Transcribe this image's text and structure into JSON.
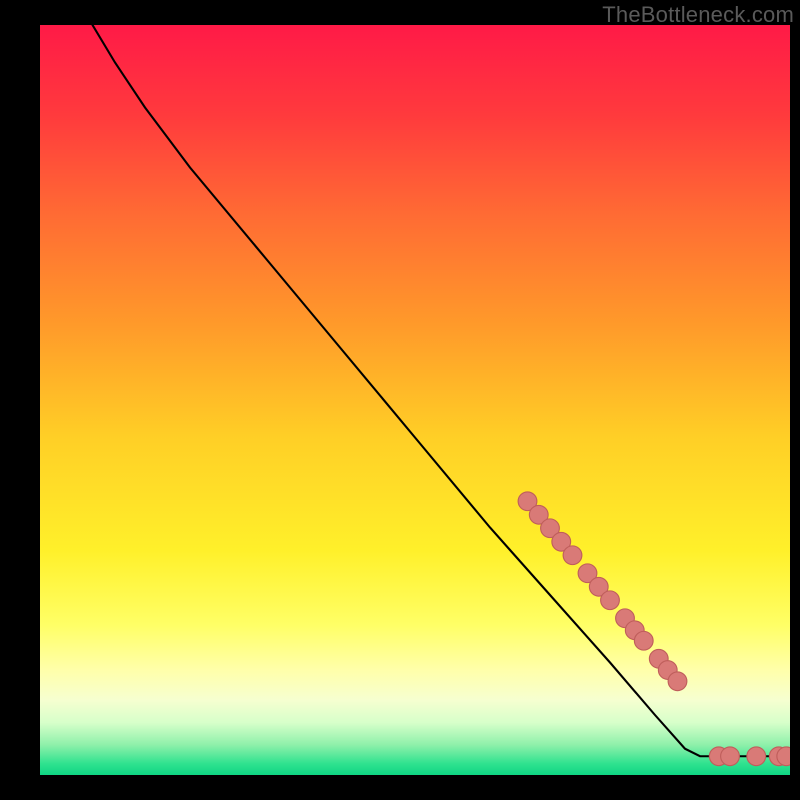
{
  "watermark": "TheBottleneck.com",
  "colors": {
    "bg": "#000000",
    "watermark_text": "#5a5a5a",
    "curve": "#000000",
    "marker_fill": "#d97a77",
    "marker_stroke": "#bf5e5b"
  },
  "chart_data": {
    "type": "line",
    "title": "",
    "xlabel": "",
    "ylabel": "",
    "xlim": [
      0,
      100
    ],
    "ylim": [
      0,
      100
    ],
    "grid": false,
    "legend": false,
    "note": "Bottleneck-style curve over a red→yellow→green vertical gradient. A single black curve descends from top-left to bottom-right; salmon markers cluster near the lower-right segment of the curve and along y≈0. Gradient bands below are inferred from the image (y is pixel-style: 0 at top, 100 at bottom).",
    "gradient_stops": [
      {
        "offset": 0.0,
        "color": "#ff1a47"
      },
      {
        "offset": 0.12,
        "color": "#ff3a3d"
      },
      {
        "offset": 0.25,
        "color": "#ff6a34"
      },
      {
        "offset": 0.4,
        "color": "#ff9a2a"
      },
      {
        "offset": 0.55,
        "color": "#ffcf26"
      },
      {
        "offset": 0.7,
        "color": "#fff02a"
      },
      {
        "offset": 0.8,
        "color": "#ffff66"
      },
      {
        "offset": 0.86,
        "color": "#ffffaa"
      },
      {
        "offset": 0.9,
        "color": "#f6ffd0"
      },
      {
        "offset": 0.93,
        "color": "#d7ffca"
      },
      {
        "offset": 0.96,
        "color": "#8ef0aa"
      },
      {
        "offset": 0.985,
        "color": "#2fe28f"
      },
      {
        "offset": 1.0,
        "color": "#0fd584"
      }
    ],
    "curve": [
      {
        "x": 7,
        "y": 0
      },
      {
        "x": 10,
        "y": 5
      },
      {
        "x": 14,
        "y": 11
      },
      {
        "x": 20,
        "y": 19
      },
      {
        "x": 30,
        "y": 31
      },
      {
        "x": 40,
        "y": 43
      },
      {
        "x": 50,
        "y": 55
      },
      {
        "x": 60,
        "y": 67
      },
      {
        "x": 68,
        "y": 76
      },
      {
        "x": 76,
        "y": 85
      },
      {
        "x": 82,
        "y": 92
      },
      {
        "x": 86,
        "y": 96.5
      },
      {
        "x": 88,
        "y": 97.5
      },
      {
        "x": 92,
        "y": 97.5
      },
      {
        "x": 96,
        "y": 97.5
      },
      {
        "x": 99,
        "y": 97.5
      }
    ],
    "markers": [
      {
        "x": 65.0,
        "y": 63.5
      },
      {
        "x": 66.5,
        "y": 65.3
      },
      {
        "x": 68.0,
        "y": 67.1
      },
      {
        "x": 69.5,
        "y": 68.9
      },
      {
        "x": 71.0,
        "y": 70.7
      },
      {
        "x": 73.0,
        "y": 73.1
      },
      {
        "x": 74.5,
        "y": 74.9
      },
      {
        "x": 76.0,
        "y": 76.7
      },
      {
        "x": 78.0,
        "y": 79.1
      },
      {
        "x": 79.3,
        "y": 80.7
      },
      {
        "x": 80.5,
        "y": 82.1
      },
      {
        "x": 82.5,
        "y": 84.5
      },
      {
        "x": 83.7,
        "y": 86.0
      },
      {
        "x": 85.0,
        "y": 87.5
      },
      {
        "x": 90.5,
        "y": 97.5
      },
      {
        "x": 92.0,
        "y": 97.5
      },
      {
        "x": 95.5,
        "y": 97.5
      },
      {
        "x": 98.5,
        "y": 97.5
      },
      {
        "x": 99.5,
        "y": 97.5
      }
    ]
  }
}
